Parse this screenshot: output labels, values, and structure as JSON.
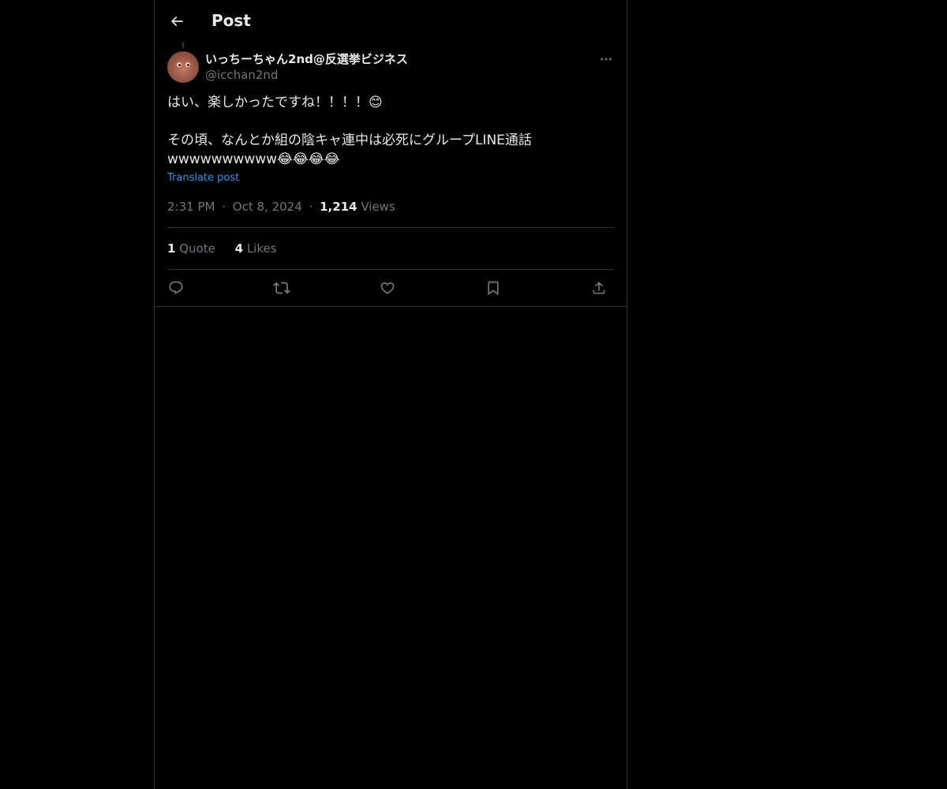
{
  "header": {
    "title": "Post",
    "back_icon": "arrow-left-icon"
  },
  "post": {
    "author": {
      "display_name": "いっちーちゃん2nd@反選挙ビジネス",
      "handle": "@icchan2nd"
    },
    "text_lines": [
      "はい、楽しかったですね！！！！😊",
      "その頃、なんとか組の陰キャ連中は必死にグループLINE通話",
      "wwwwwwwwww😂😂😂😂"
    ],
    "translate_label": "Translate post",
    "time": "2:31 PM",
    "date": "Oct 8, 2024",
    "dot": "·",
    "views_count": "1,214",
    "views_label": "Views",
    "quotes_count": "1",
    "quotes_label": "Quote",
    "likes_count": "4",
    "likes_label": "Likes"
  },
  "actions": [
    "reply-icon",
    "repost-icon",
    "like-icon",
    "bookmark-icon",
    "share-icon"
  ],
  "colors": {
    "background": "#000000",
    "text": "#e7e9ea",
    "muted": "#71767b",
    "link": "#1d9bf0",
    "border": "#2f3336"
  }
}
